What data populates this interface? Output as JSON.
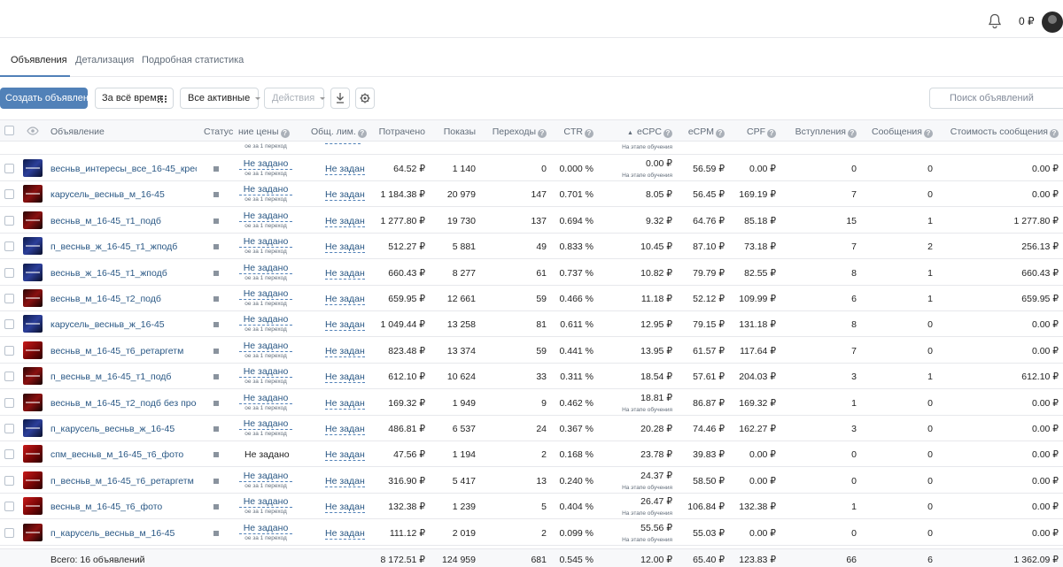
{
  "header": {
    "balance": "0 ₽",
    "bell_icon": "bell-icon",
    "avatar": "avatar"
  },
  "tabs": [
    {
      "label": "Объявления",
      "active": true
    },
    {
      "label": "Детализация",
      "active": false
    },
    {
      "label": "Подробная статистика",
      "active": false
    }
  ],
  "toolbar": {
    "create_label": "Создать объявление",
    "period_label": "За всё время",
    "filter_label": "Все активные",
    "actions_label": "Действия",
    "search_placeholder": "Поиск объявлений"
  },
  "columns": {
    "ad": "Объявление",
    "status": "Статус",
    "price": "ние цены",
    "limit": "Общ. лим.",
    "spent": "Потрачено",
    "impressions": "Показы",
    "clicks": "Переходы",
    "ctr": "CTR",
    "ecpc": "eCPC",
    "ecpm": "eCPM",
    "cpf": "CPF",
    "joins": "Вступления",
    "messages": "Сообщения",
    "msg_cost": "Стоимость сообщения"
  },
  "price_sub": "ое за 1 переход",
  "learning_label": "На этапе обучения",
  "partial_row": {
    "price_sub": "ое за 1 переход",
    "learning": "На этапе обучения"
  },
  "rows": [
    {
      "name": "весньв_интересы_все_16-45_крео1",
      "thumb": "blue",
      "price": "Не задано",
      "price_link": true,
      "limit": "Не задан",
      "spent": "64.52 ₽",
      "impressions": "1 140",
      "clicks": "0",
      "ctr": "0.000 %",
      "ecpc": "0.00 ₽",
      "learning": true,
      "ecpm": "56.59 ₽",
      "cpf": "0.00 ₽",
      "joins": "0",
      "messages": "0",
      "msg_cost": "0.00 ₽"
    },
    {
      "name": "карусель_весньв_м_16-45",
      "thumb": "dark",
      "price": "Не задано",
      "price_link": true,
      "limit": "Не задан",
      "spent": "1 184.38 ₽",
      "impressions": "20 979",
      "clicks": "147",
      "ctr": "0.701 %",
      "ecpc": "8.05 ₽",
      "learning": false,
      "ecpm": "56.45 ₽",
      "cpf": "169.19 ₽",
      "joins": "7",
      "messages": "0",
      "msg_cost": "0.00 ₽"
    },
    {
      "name": "весньв_м_16-45_т1_подб",
      "thumb": "dark",
      "price": "Не задано",
      "price_link": true,
      "limit": "Не задан",
      "spent": "1 277.80 ₽",
      "impressions": "19 730",
      "clicks": "137",
      "ctr": "0.694 %",
      "ecpc": "9.32 ₽",
      "learning": false,
      "ecpm": "64.76 ₽",
      "cpf": "85.18 ₽",
      "joins": "15",
      "messages": "1",
      "msg_cost": "1 277.80 ₽"
    },
    {
      "name": "п_весньв_ж_16-45_т1_жподб",
      "thumb": "blue",
      "price": "Не задано",
      "price_link": true,
      "limit": "Не задан",
      "spent": "512.27 ₽",
      "impressions": "5 881",
      "clicks": "49",
      "ctr": "0.833 %",
      "ecpc": "10.45 ₽",
      "learning": false,
      "ecpm": "87.10 ₽",
      "cpf": "73.18 ₽",
      "joins": "7",
      "messages": "2",
      "msg_cost": "256.13 ₽"
    },
    {
      "name": "весньв_ж_16-45_т1_жподб",
      "thumb": "blue",
      "price": "Не задано",
      "price_link": true,
      "limit": "Не задан",
      "spent": "660.43 ₽",
      "impressions": "8 277",
      "clicks": "61",
      "ctr": "0.737 %",
      "ecpc": "10.82 ₽",
      "learning": false,
      "ecpm": "79.79 ₽",
      "cpf": "82.55 ₽",
      "joins": "8",
      "messages": "1",
      "msg_cost": "660.43 ₽"
    },
    {
      "name": "весньв_м_16-45_т2_подб",
      "thumb": "dark",
      "price": "Не задано",
      "price_link": true,
      "limit": "Не задан",
      "spent": "659.95 ₽",
      "impressions": "12 661",
      "clicks": "59",
      "ctr": "0.466 %",
      "ecpc": "11.18 ₽",
      "learning": false,
      "ecpm": "52.12 ₽",
      "cpf": "109.99 ₽",
      "joins": "6",
      "messages": "1",
      "msg_cost": "659.95 ₽"
    },
    {
      "name": "карусель_весньв_ж_16-45",
      "thumb": "blue",
      "price": "Не задано",
      "price_link": true,
      "limit": "Не задан",
      "spent": "1 049.44 ₽",
      "impressions": "13 258",
      "clicks": "81",
      "ctr": "0.611 %",
      "ecpc": "12.95 ₽",
      "learning": false,
      "ecpm": "79.15 ₽",
      "cpf": "131.18 ₽",
      "joins": "8",
      "messages": "0",
      "msg_cost": "0.00 ₽"
    },
    {
      "name": "весньв_м_16-45_т6_ретаргетм",
      "thumb": "red",
      "price": "Не задано",
      "price_link": true,
      "limit": "Не задан",
      "spent": "823.48 ₽",
      "impressions": "13 374",
      "clicks": "59",
      "ctr": "0.441 %",
      "ecpc": "13.95 ₽",
      "learning": false,
      "ecpm": "61.57 ₽",
      "cpf": "117.64 ₽",
      "joins": "7",
      "messages": "0",
      "msg_cost": "0.00 ₽"
    },
    {
      "name": "п_весньв_м_16-45_т1_подб",
      "thumb": "dark",
      "price": "Не задано",
      "price_link": true,
      "limit": "Не задан",
      "spent": "612.10 ₽",
      "impressions": "10 624",
      "clicks": "33",
      "ctr": "0.311 %",
      "ecpc": "18.54 ₽",
      "learning": false,
      "ecpm": "57.61 ₽",
      "cpf": "204.03 ₽",
      "joins": "3",
      "messages": "1",
      "msg_cost": "612.10 ₽"
    },
    {
      "name": "весньв_м_16-45_т2_подб без прос…",
      "thumb": "dark",
      "price": "Не задано",
      "price_link": true,
      "limit": "Не задан",
      "spent": "169.32 ₽",
      "impressions": "1 949",
      "clicks": "9",
      "ctr": "0.462 %",
      "ecpc": "18.81 ₽",
      "learning": true,
      "ecpm": "86.87 ₽",
      "cpf": "169.32 ₽",
      "joins": "1",
      "messages": "0",
      "msg_cost": "0.00 ₽"
    },
    {
      "name": "п_карусель_весньв_ж_16-45",
      "thumb": "blue",
      "price": "Не задано",
      "price_link": true,
      "limit": "Не задан",
      "spent": "486.81 ₽",
      "impressions": "6 537",
      "clicks": "24",
      "ctr": "0.367 %",
      "ecpc": "20.28 ₽",
      "learning": false,
      "ecpm": "74.46 ₽",
      "cpf": "162.27 ₽",
      "joins": "3",
      "messages": "0",
      "msg_cost": "0.00 ₽"
    },
    {
      "name": "спм_весньв_м_16-45_т6_фото",
      "thumb": "red",
      "price": "Не задано",
      "price_link": false,
      "limit": "Не задан",
      "spent": "47.56 ₽",
      "impressions": "1 194",
      "clicks": "2",
      "ctr": "0.168 %",
      "ecpc": "23.78 ₽",
      "learning": false,
      "ecpm": "39.83 ₽",
      "cpf": "0.00 ₽",
      "joins": "0",
      "messages": "0",
      "msg_cost": "0.00 ₽"
    },
    {
      "name": "п_весньв_м_16-45_т6_ретаргетм",
      "thumb": "red",
      "price": "Не задано",
      "price_link": true,
      "limit": "Не задан",
      "spent": "316.90 ₽",
      "impressions": "5 417",
      "clicks": "13",
      "ctr": "0.240 %",
      "ecpc": "24.37 ₽",
      "learning": true,
      "ecpm": "58.50 ₽",
      "cpf": "0.00 ₽",
      "joins": "0",
      "messages": "0",
      "msg_cost": "0.00 ₽"
    },
    {
      "name": "весньв_м_16-45_т6_фото",
      "thumb": "red",
      "price": "Не задано",
      "price_link": true,
      "limit": "Не задан",
      "spent": "132.38 ₽",
      "impressions": "1 239",
      "clicks": "5",
      "ctr": "0.404 %",
      "ecpc": "26.47 ₽",
      "learning": true,
      "ecpm": "106.84 ₽",
      "cpf": "132.38 ₽",
      "joins": "1",
      "messages": "0",
      "msg_cost": "0.00 ₽"
    },
    {
      "name": "п_карусель_весньв_м_16-45",
      "thumb": "dark",
      "price": "Не задано",
      "price_link": true,
      "limit": "Не задан",
      "spent": "111.12 ₽",
      "impressions": "2 019",
      "clicks": "2",
      "ctr": "0.099 %",
      "ecpc": "55.56 ₽",
      "learning": true,
      "ecpm": "55.03 ₽",
      "cpf": "0.00 ₽",
      "joins": "0",
      "messages": "0",
      "msg_cost": "0.00 ₽"
    }
  ],
  "totals": {
    "label": "Всего: 16 объявлений",
    "spent": "8 172.51 ₽",
    "impressions": "124 959",
    "clicks": "681",
    "ctr": "0.545 %",
    "ecpc": "12.00 ₽",
    "ecpm": "65.40 ₽",
    "cpf": "123.83 ₽",
    "joins": "66",
    "messages": "6",
    "msg_cost": "1 362.09 ₽"
  },
  "colors": {
    "accent": "#5181b8",
    "link": "#2a5885",
    "muted": "#626d7a",
    "border": "#e7e8ec"
  }
}
